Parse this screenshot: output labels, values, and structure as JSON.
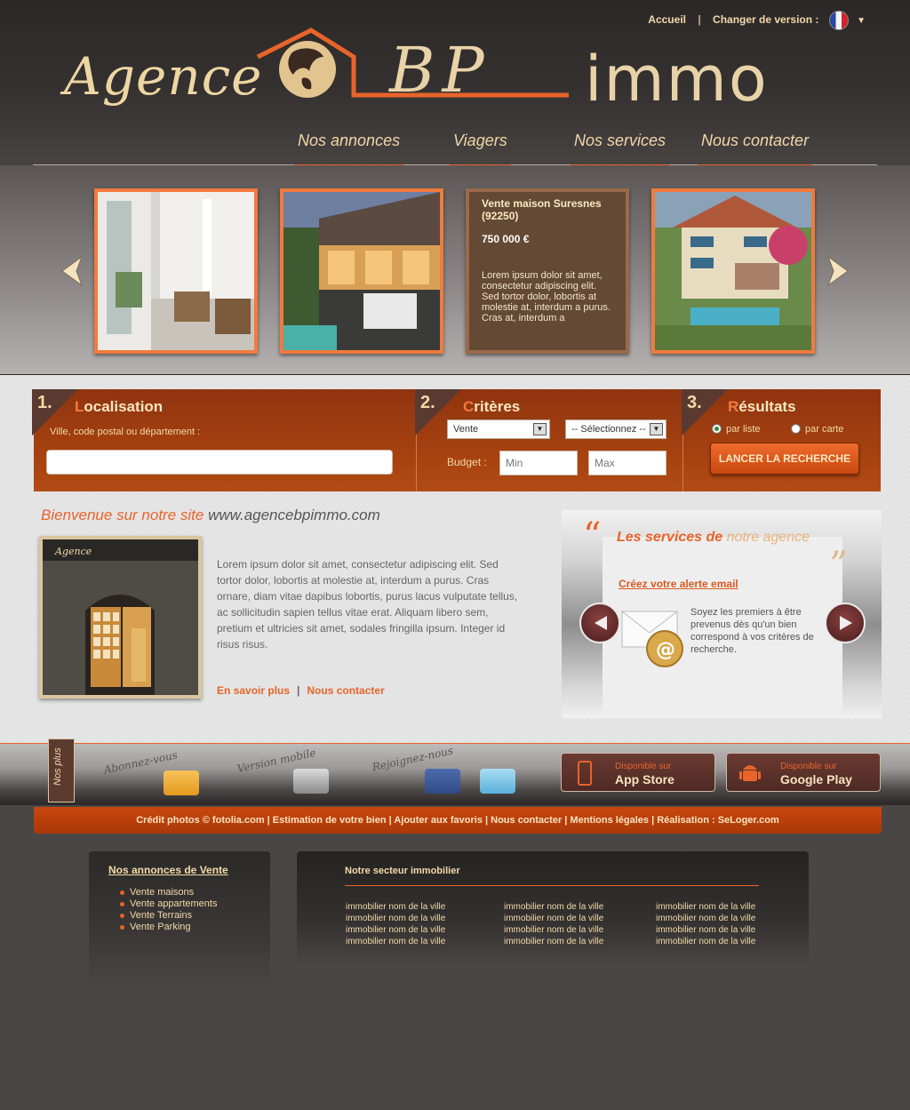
{
  "topnav": {
    "home": "Accueil",
    "sep": "|",
    "version_label": "Changer de version :"
  },
  "logo": {
    "agence": "Agence",
    "bp": "BP",
    "immo": "immo"
  },
  "mainnav": [
    {
      "label": "Nos annonces"
    },
    {
      "label": "Viagers"
    },
    {
      "label": "Nos services"
    },
    {
      "label": "Nous contacter"
    }
  ],
  "carousel": {
    "featured": {
      "title": "Vente maison Suresnes (92250)",
      "price": "750 000 €",
      "desc": "Lorem ipsum dolor sit amet, consectetur adipiscing elit. Sed tortor dolor, lobortis at molestie at, interdum a purus. Cras at, interdum a"
    }
  },
  "search": {
    "step1": {
      "num": "1.",
      "title_first": "L",
      "title_rest": "ocalisation",
      "label": "Ville, code postal ou département :",
      "value": ""
    },
    "step2": {
      "num": "2.",
      "title_first": "C",
      "title_rest": "ritères",
      "type_value": "Vente",
      "select_value": "-- Sélectionnez --",
      "budget_label": "Budget :",
      "min_placeholder": "Min",
      "max_placeholder": "Max"
    },
    "step3": {
      "num": "3.",
      "title_first": "R",
      "title_rest": "ésultats",
      "opt_list": "par liste",
      "opt_map": "par carte",
      "button": "LANCER LA RECHERCHE"
    }
  },
  "welcome": {
    "title": "Bienvenue sur notre site",
    "site": "www.agencebpimmo.com",
    "text": "Lorem ipsum dolor sit amet, consectetur adipiscing elit. Sed tortor dolor, lobortis at molestie at, interdum a purus. Cras ornare, diam vitae dapibus lobortis, purus lacus vulputate tellus, ac sollicitudin sapien tellus vitae erat. Aliquam libero sem, pretium et ultricies sit amet, sodales fringilla ipsum. Integer id risus risus.",
    "more": "En savoir plus",
    "sep": "|",
    "contact": "Nous contacter",
    "photo_sign": "Agence"
  },
  "services": {
    "title_a": "Les services de",
    "title_b": "notre agence",
    "link": "Créez votre alerte email",
    "desc": "Soyez les premiers à être prevenus dès qu'un bien correspond à vos critères de recherche."
  },
  "strip": {
    "tag": "Nos plus",
    "subscribe": "Abonnez-vous",
    "mobile": "Version mobile",
    "join": "Rejoignez-nous",
    "appstore_small": "Disponible sur",
    "appstore": "App Store",
    "play_small": "Disponible sur",
    "play": "Google Play"
  },
  "credit": "Crédit photos © fotolia.com | Estimation de votre bien | Ajouter aux favoris | Nous contacter | Mentions légales | Réalisation : SeLoger.com",
  "annonces": {
    "title": "Nos annonces de Vente",
    "items": [
      "Vente maisons",
      "Vente appartements",
      "Vente Terrains",
      "Vente Parking"
    ]
  },
  "secteur": {
    "title": "Notre secteur immobilier",
    "col1": [
      "immobilier nom de la ville",
      "immobilier nom de la ville",
      "immobilier nom de la ville",
      "immobilier nom de la ville"
    ],
    "col2": [
      "immobilier nom de la ville",
      "immobilier nom de la ville",
      "immobilier nom de la ville",
      "immobilier nom de la ville"
    ],
    "col3": [
      "immobilier nom de la ville",
      "immobilier nom de la ville",
      "immobilier nom de la ville",
      "immobilier nom de la ville"
    ]
  },
  "colors": {
    "accent": "#e8642a",
    "cream": "#f3d9a8",
    "bar": "#a5410f",
    "dark": "#2b2827"
  }
}
